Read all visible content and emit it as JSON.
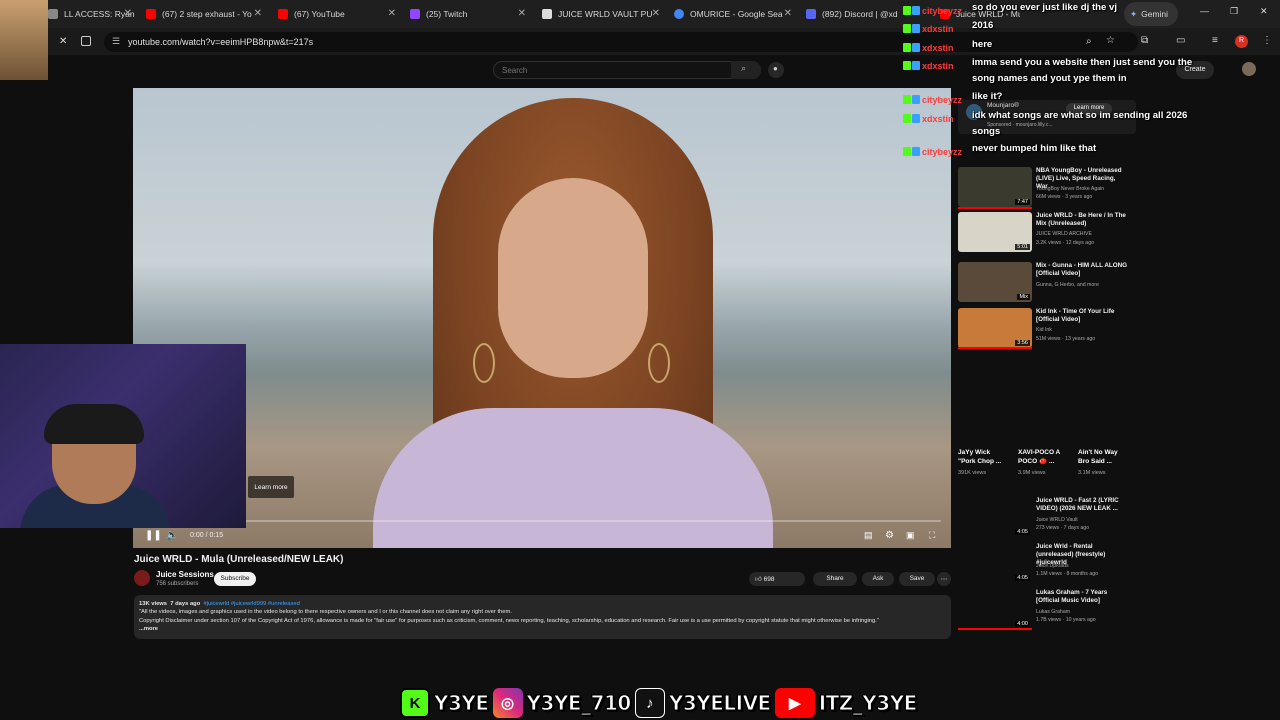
{
  "browser": {
    "tabs": [
      {
        "label": "LL ACCESS: Ryan G",
        "favicon": "#888888"
      },
      {
        "label": "(67) 2 step exhaust - Yo",
        "favicon": "#ff0000"
      },
      {
        "label": "(67) YouTube",
        "favicon": "#ff0000"
      },
      {
        "label": "(25) Twitch",
        "favicon": "#9146ff"
      },
      {
        "label": "JUICE WRLD VAULT PU",
        "favicon": "#dddddd"
      },
      {
        "label": "OMURICE - Google Sea",
        "favicon": "#4285f4"
      },
      {
        "label": "(892) Discord | @xd",
        "favicon": "#5865f2"
      },
      {
        "label": "Juice WRLD - Mula",
        "favicon": "#ff0000"
      }
    ],
    "gemini_label": "Gemini",
    "url": "youtube.com/watch?v=eeimHPB8npw&t=217s",
    "profile_initial": "R"
  },
  "youtube": {
    "search_placeholder": "Search",
    "create_label": "Create",
    "video": {
      "learn_more": "Learn more",
      "time": "0:00 / 0:15",
      "progress": 0.0
    },
    "title": "Juice WRLD - Mula (Unreleased/NEW LEAK)",
    "channel": {
      "name": "Juice Sessions",
      "subs": "756 subscribers",
      "subscribe": "Subscribe"
    },
    "actions": {
      "likes": "698",
      "share": "Share",
      "ask": "Ask",
      "save": "Save"
    },
    "description": {
      "views": "13K views",
      "age": "7 days ago",
      "tags": "#juicewrld #juicewrld999 #unreleased",
      "line1": "\"All the videos, images and graphics used in the video belong to there respective owners and I or this channel does not claim any right over them.",
      "line2": "Copyright Disclaimer under section 107 of the Copyright Act of 1976, allowance is made for \"fair use\" for purposes such as criticism, comment, news reporting, teaching, scholarship, education and research. Fair use is a use permitted by copyright statute that might otherwise be infringing.\"",
      "more": "...more"
    },
    "ad": {
      "name": "Mounjaro®",
      "sponsored": "Sponsored · mounjaro.lilly.c...",
      "learn_more": "Learn more"
    },
    "recommendations": [
      {
        "title": "NBA YoungBoy - Unreleased (LIVE) Live, Speed Racing, War",
        "channel": "YoungBoy Never Broke Again",
        "meta": "66M views · 3 years ago",
        "duration": "7:47",
        "thumb": "#3a3a2e"
      },
      {
        "title": "Juice WRLD - Be Here / In The Mix (Unreleased)",
        "channel": "JUICE WRLD ARCHIVE",
        "meta": "3.2K views · 12 days ago",
        "duration": "5:01",
        "thumb": "#d9d4c8"
      },
      {
        "title": "Mix - Gunna - HIM ALL ALONG [Official Video]",
        "channel": "Gunna, G Herbo, and more",
        "meta": "",
        "duration": "Mix",
        "thumb": "#5a4a3a"
      },
      {
        "title": "Kid Ink - Time Of Your Life [Official Video]",
        "channel": "Kid Ink",
        "meta": "51M views · 13 years ago",
        "duration": "3:56",
        "thumb": "#c77a3a"
      }
    ],
    "shorts": [
      {
        "title": "JaYy Wick \"Pork Chop ...",
        "views": "391K views"
      },
      {
        "title": "XAVI-POCO A POCO 🍅 ...",
        "views": "3.9M views"
      },
      {
        "title": "Ain't No Way Bro Said ...",
        "views": "3.1M views"
      }
    ],
    "recommendations2": [
      {
        "title": "Juice WRLD - Fast 2 (LYRIC VIDEO) (2026 NEW LEAK ...",
        "channel": "Juice WRLD Vault",
        "meta": "273 views · 7 days ago",
        "duration": "4:05"
      },
      {
        "title": "Juice Wrld - Rental (unreleased) (freestyle) #juicewrld",
        "channel": "Juice.Uploads",
        "meta": "1.1M views · 8 months ago",
        "duration": "4:05"
      },
      {
        "title": "Lukas Graham - 7 Years [Official Music Video]",
        "channel": "Lukas Graham",
        "meta": "1.7B views · 10 years ago",
        "duration": "4:00"
      }
    ]
  },
  "chat": [
    {
      "user": "citybeyzz",
      "color": "#ff3b3b",
      "message": "so do you ever just like dj the vj"
    },
    {
      "user": "xdxstin",
      "color": "#ff3b3b",
      "message": "2016"
    },
    {
      "user": "xdxstin",
      "color": "#ff3b3b",
      "message": "here"
    },
    {
      "user": "xdxstin",
      "color": "#ff3b3b",
      "message": "imma send you a website then just send you the song names and yout ype them in"
    },
    {
      "user": "citybeyzz",
      "color": "#ff3b3b",
      "message": "like it?"
    },
    {
      "user": "xdxstin",
      "color": "#ff3b3b",
      "message": "idk what songs are what so im sending all 2026 songs"
    },
    {
      "user": "citybeyzz",
      "color": "#ff3b3b",
      "message": "never bumped him like that"
    }
  ],
  "socials": [
    {
      "platform": "kick-icon",
      "handle": "Y3YE",
      "color": "#53fc18",
      "glyph": "K"
    },
    {
      "platform": "instagram-icon",
      "handle": "Y3YE_710",
      "color": "#e1306c",
      "glyph": "◎"
    },
    {
      "platform": "tiktok-icon",
      "handle": "Y3YELIVE",
      "color": "#111111",
      "glyph": "♪"
    },
    {
      "platform": "youtube-icon",
      "handle": "ITZ_Y3YE",
      "color": "#ff0000",
      "glyph": "▶"
    }
  ]
}
